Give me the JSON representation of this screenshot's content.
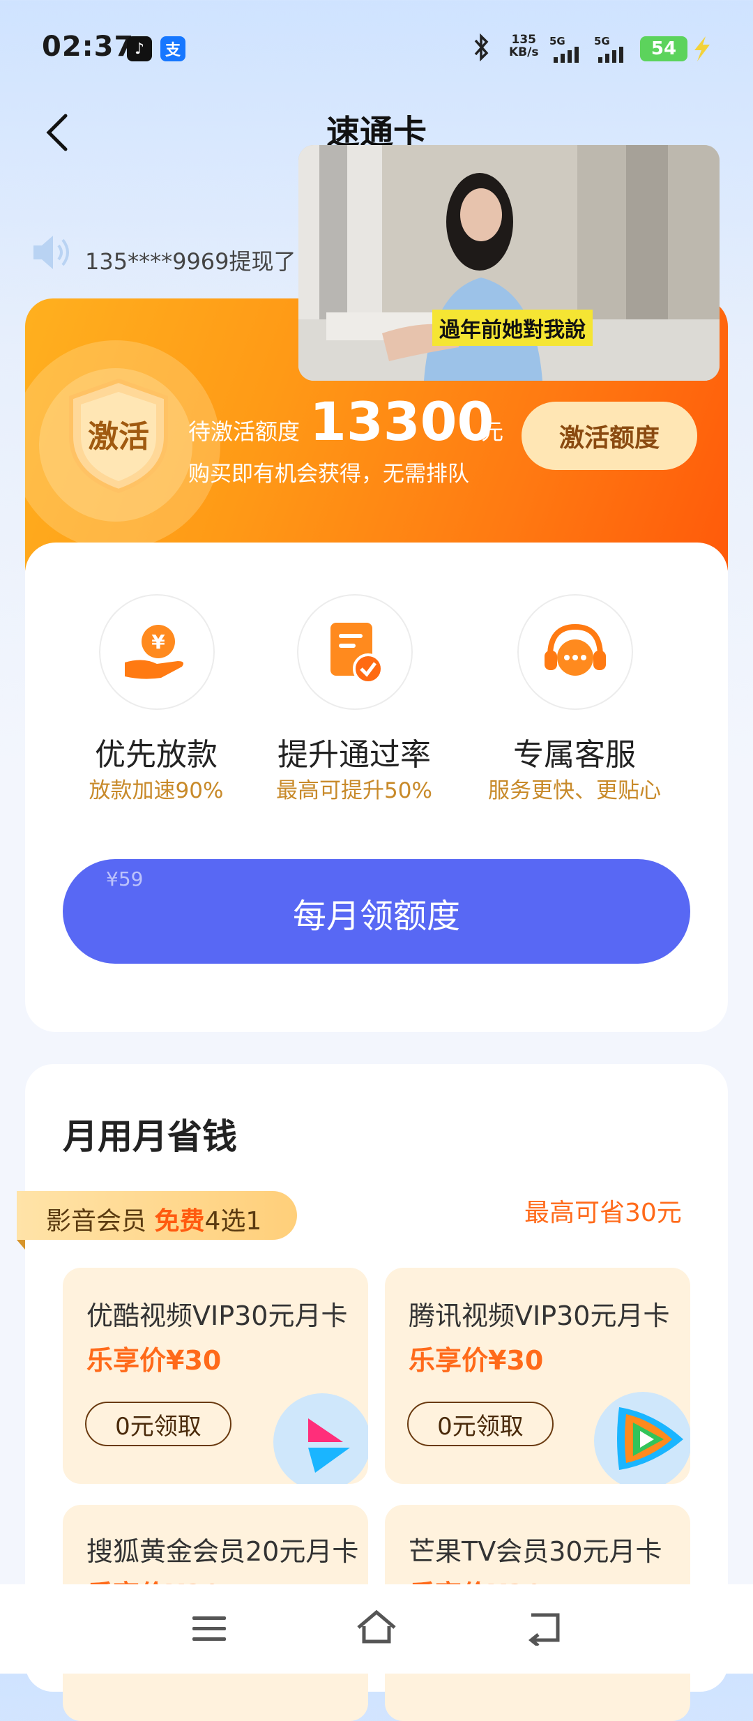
{
  "status": {
    "time": "02:37",
    "net_speed_value": "135",
    "net_speed_unit": "KB/s",
    "signal1": "5G",
    "signal2": "5G",
    "battery": "54",
    "app_badges": [
      "tiktok-icon",
      "alipay-icon"
    ]
  },
  "header": {
    "title": "速通卡"
  },
  "notice": {
    "text": "135****9969提现了"
  },
  "video": {
    "caption": "過年前她對我說"
  },
  "banner": {
    "badge": "激活",
    "pending_label": "待激活额度",
    "amount": "13300",
    "unit": "元",
    "subline": "购买即有机会获得，无需排队",
    "button": "激活额度"
  },
  "features": [
    {
      "title": "优先放款",
      "sub": "放款加速90%",
      "icon": "money-hand-icon"
    },
    {
      "title": "提升通过率",
      "sub": "最高可提升50%",
      "icon": "document-check-icon"
    },
    {
      "title": "专属客服",
      "sub": "服务更快、更贴心",
      "icon": "headset-icon"
    }
  ],
  "cta": {
    "price": "¥59",
    "label": "每月领额度"
  },
  "savings": {
    "title": "月用月省钱",
    "tag_prefix": "影音会员 ",
    "tag_free": "免费",
    "tag_suffix": "4选1",
    "max_save": "最高可省30元",
    "items": [
      {
        "name": "优酷视频VIP30元月卡",
        "price": "乐享价¥30",
        "button": "0元领取"
      },
      {
        "name": "腾讯视频VIP30元月卡",
        "price": "乐享价¥30",
        "button": "0元领取"
      },
      {
        "name": "搜狐黄金会员20元月卡",
        "price": "乐享价¥20"
      },
      {
        "name": "芒果TV会员30元月卡",
        "price": "乐享价¥30"
      }
    ]
  },
  "colors": {
    "accent_blue": "#5868f4",
    "orange": "#ff7a12",
    "gold_text": "#c88a2a"
  }
}
